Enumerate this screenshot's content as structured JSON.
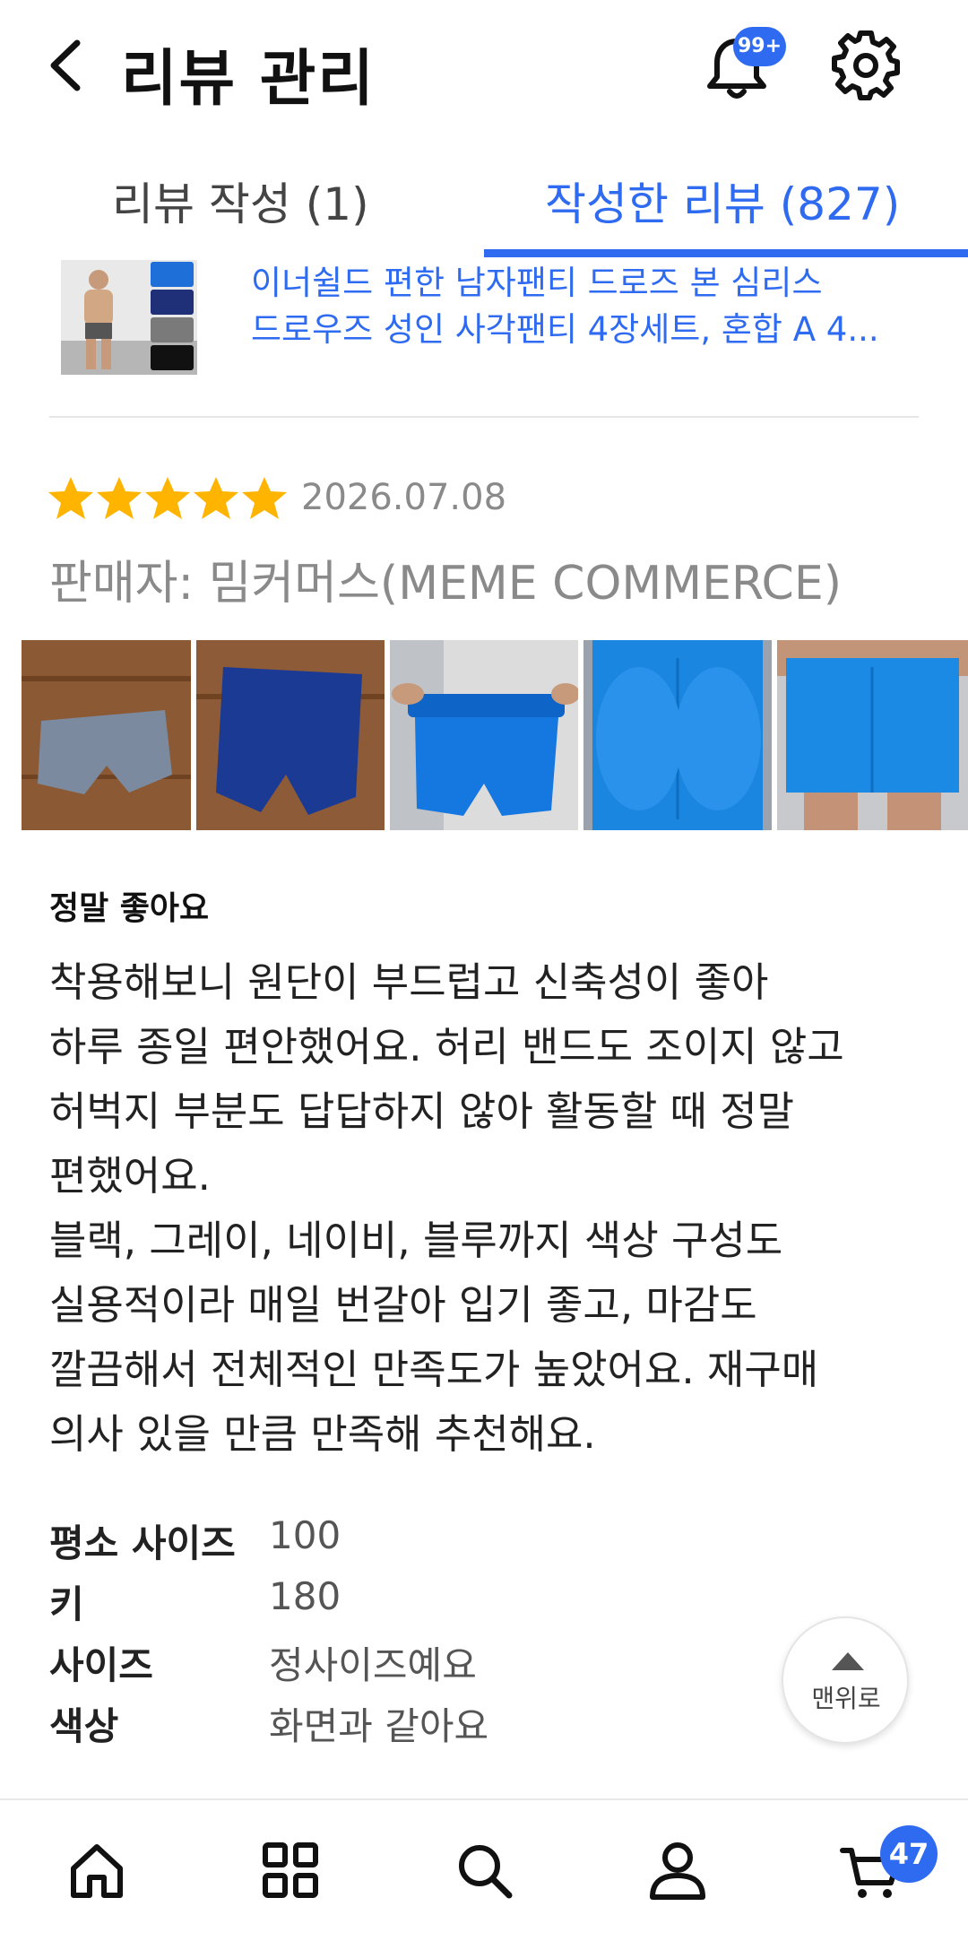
{
  "header": {
    "title": "리뷰 관리",
    "notification_badge": "99+",
    "back_icon": "chevron-left-icon",
    "bell_icon": "bell-icon",
    "settings_icon": "gear-icon"
  },
  "tabs": [
    {
      "label": "리뷰 작성 (1)",
      "active": false
    },
    {
      "label": "작성한 리뷰 (827)",
      "active": true
    }
  ],
  "product": {
    "name_line1": "이너쉴드 편한 남자팬티 드로즈 본 심리스",
    "name_line2": "드로우즈 성인 사각팬티 4장세트, 혼합 A 4..."
  },
  "review": {
    "rating": 5,
    "rating_max": 5,
    "date": "2026.07.08",
    "seller": "판매자: 밈커머스(MEME COMMERCE)",
    "photos_count": 5,
    "title": "정말 좋아요",
    "body_lines": [
      "착용해보니 원단이 부드럽고 신축성이 좋아",
      "하루 종일 편안했어요. 허리 밴드도 조이지 않고",
      "허벅지 부분도 답답하지 않아 활동할 때 정말",
      "편했어요.",
      "블랙, 그레이, 네이비, 블루까지 색상 구성도",
      "실용적이라 매일 번갈아 입기 좋고, 마감도",
      "깔끔해서 전체적인 만족도가 높았어요. 재구매",
      "의사 있을 만큼 만족해 추천해요."
    ],
    "specs": [
      {
        "label": "평소 사이즈",
        "value": "100"
      },
      {
        "label": "키",
        "value": "180"
      },
      {
        "label": "사이즈",
        "value": "정사이즈예요"
      },
      {
        "label": "색상",
        "value": "화면과 같아요"
      }
    ]
  },
  "scroll_top": {
    "label": "맨위로"
  },
  "bottom_nav": {
    "items": [
      "home-icon",
      "grid-menu-icon",
      "search-icon",
      "profile-icon",
      "cart-icon"
    ],
    "cart_badge": "47"
  },
  "colors": {
    "accent": "#2f6bf0",
    "star": "#ffb400",
    "muted_text": "#8a8a8a"
  }
}
